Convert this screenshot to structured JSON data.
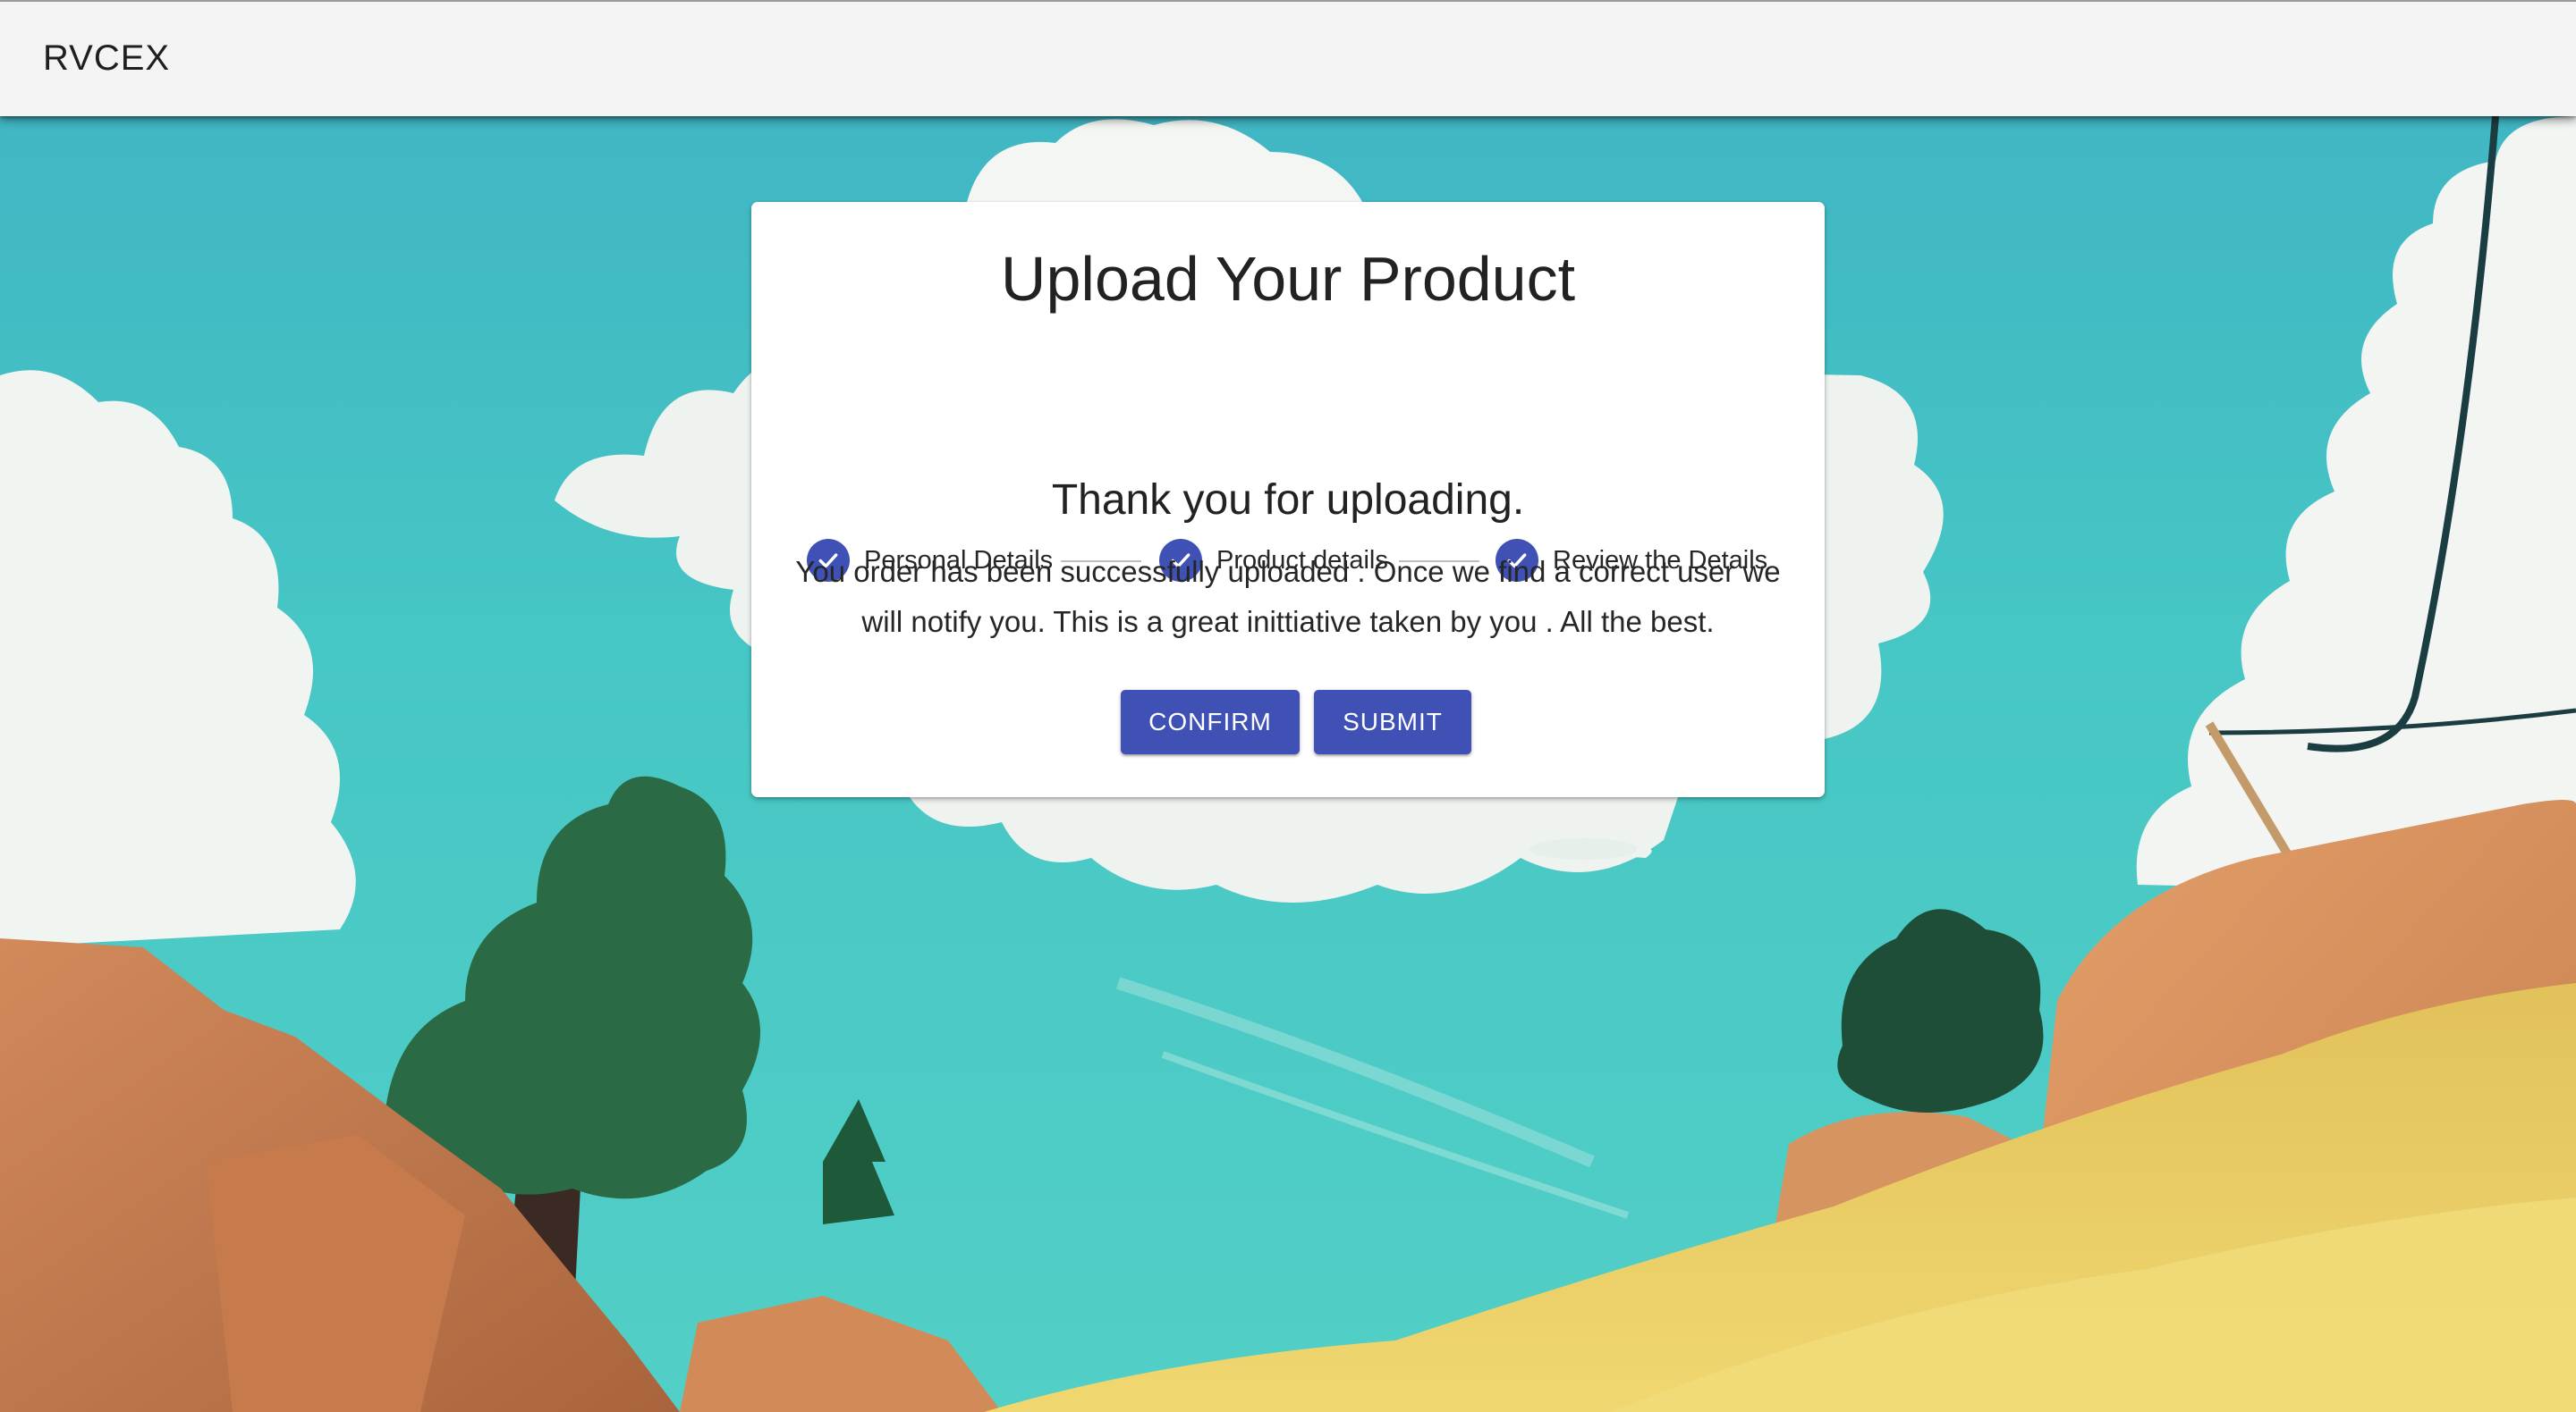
{
  "app_bar": {
    "title": "RVCEX"
  },
  "card": {
    "title": "Upload Your Product",
    "stepper": {
      "steps": [
        {
          "label": "Personal Details",
          "completed": true,
          "icon": "check-circle-icon"
        },
        {
          "label": "Product details",
          "completed": true,
          "icon": "check-circle-icon"
        },
        {
          "label": "Review the Details",
          "completed": true,
          "icon": "check-circle-icon"
        }
      ]
    },
    "heading": "Thank you for uploading.",
    "message_line1": "You order has been successfully uploaded . Once we find a correct user we",
    "message_line2": "will notify you. This is a great inittiative taken by you . All the best.",
    "buttons": {
      "confirm": "CONFIRM",
      "submit": "SUBMIT"
    }
  },
  "colors": {
    "primary": "#3f51b5",
    "app_bar_bg": "#f4f4f4",
    "sky": "#46c6c5",
    "connector": "#bdbdbd"
  }
}
